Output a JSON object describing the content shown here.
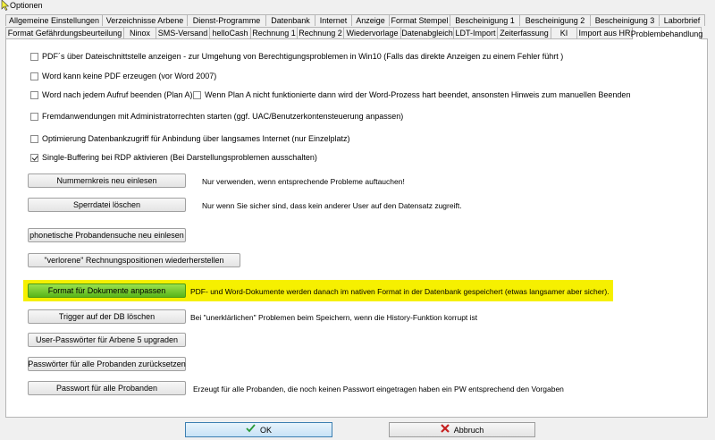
{
  "window": {
    "title": "Optionen"
  },
  "tabs_row1": [
    "Allgemeine Einstellungen",
    "Verzeichnisse Arbene",
    "Dienst-Programme",
    "Datenbank",
    "Internet",
    "Anzeige",
    "Format Stempel",
    "Bescheinigung 1",
    "Bescheinigung 2",
    "Bescheinigung 3",
    "Laborbrief"
  ],
  "tabs_row2": [
    "Format Gefährdungsbeurteilung",
    "Ninox",
    "SMS-Versand",
    "helloCash",
    "Rechnung 1",
    "Rechnung 2",
    "Wiedervorlage",
    "Datenabgleich",
    "LDT-Import",
    "Zeiterfassung",
    "KI",
    "Import aus HR",
    "Problembehandlung"
  ],
  "active_tab": "Problembehandlung",
  "checkboxes": {
    "pdf_dateischnittstelle": {
      "label": "PDF´s über Dateischnittstelle anzeigen -  zur Umgehung von  Berechtigungsproblemen in Win10 (Falls das direkte Anzeigen zu einem Fehler führt )",
      "checked": false
    },
    "word_kein_pdf": {
      "label": "Word kann keine PDF erzeugen (vor Word 2007)",
      "checked": false
    },
    "word_beenden": {
      "label": "Word nach jedem Aufruf beenden (Plan A)",
      "checked": false
    },
    "plan_b": {
      "label": "Wenn Plan A nicht funktionierte dann wird der Word-Prozess hart beendet, ansonsten Hinweis zum manuellen Beenden",
      "checked": false
    },
    "fremdanwendungen": {
      "label": "Fremdanwendungen mit Administratorrechten starten (ggf. UAC/Benutzerkontensteuerung anpassen)",
      "checked": false
    },
    "optimierung_db": {
      "label": "Optimierung Datenbankzugriff für  Anbindung über langsames Internet (nur Einzelplatz)",
      "checked": false
    },
    "single_buffering": {
      "label": "Single-Buffering bei RDP aktivieren (Bei Darstellungsproblemen ausschalten)",
      "checked": true
    }
  },
  "buttons": {
    "nummernkreis": "Nummernkreis neu einlesen",
    "sperrdatei": "Sperrdatei löschen",
    "phonetische_suche": "phonetische Probandensuche neu einlesen",
    "verlorene_positionen": "\"verlorene\" Rechnungspositionen wiederherstellen",
    "format_dokumente": "Format für Dokumente anpassen",
    "trigger_loeschen": "Trigger auf der DB löschen",
    "user_passwoerter": "User-Passwörter für Arbene 5 upgraden",
    "passwoerter_zuruecksetzen": "Passwörter für alle Probanden zurücksetzen",
    "passwort_alle": "Passwort für alle Probanden",
    "ok": "OK",
    "abbruch": "Abbruch"
  },
  "notes": {
    "nummernkreis": "Nur verwenden, wenn entsprechende Probleme auftauchen!",
    "sperrdatei": "Nur wenn Sie sicher sind, dass kein anderer User auf den Datensatz zugreift.",
    "format_dokumente": "PDF- und Word-Dokumente werden danach im nativen Format in der Datenbank gespeichert  (etwas langsamer aber sicher).",
    "trigger": "Bei \"unerklärlichen\" Problemen beim Speichern, wenn die History-Funktion korrupt ist",
    "passwort_alle": "Erzeugt für alle Probanden, die noch keinen Passwort eingetragen haben ein PW entsprechend den Vorgaben"
  },
  "colors": {
    "highlight": "#f6f000",
    "green_button": "#6cc52a",
    "ok_accent": "#3c7fb1"
  },
  "icons": {
    "ok": "check-icon",
    "abbruch": "x-icon",
    "cursor": "mouse-cursor-icon"
  }
}
